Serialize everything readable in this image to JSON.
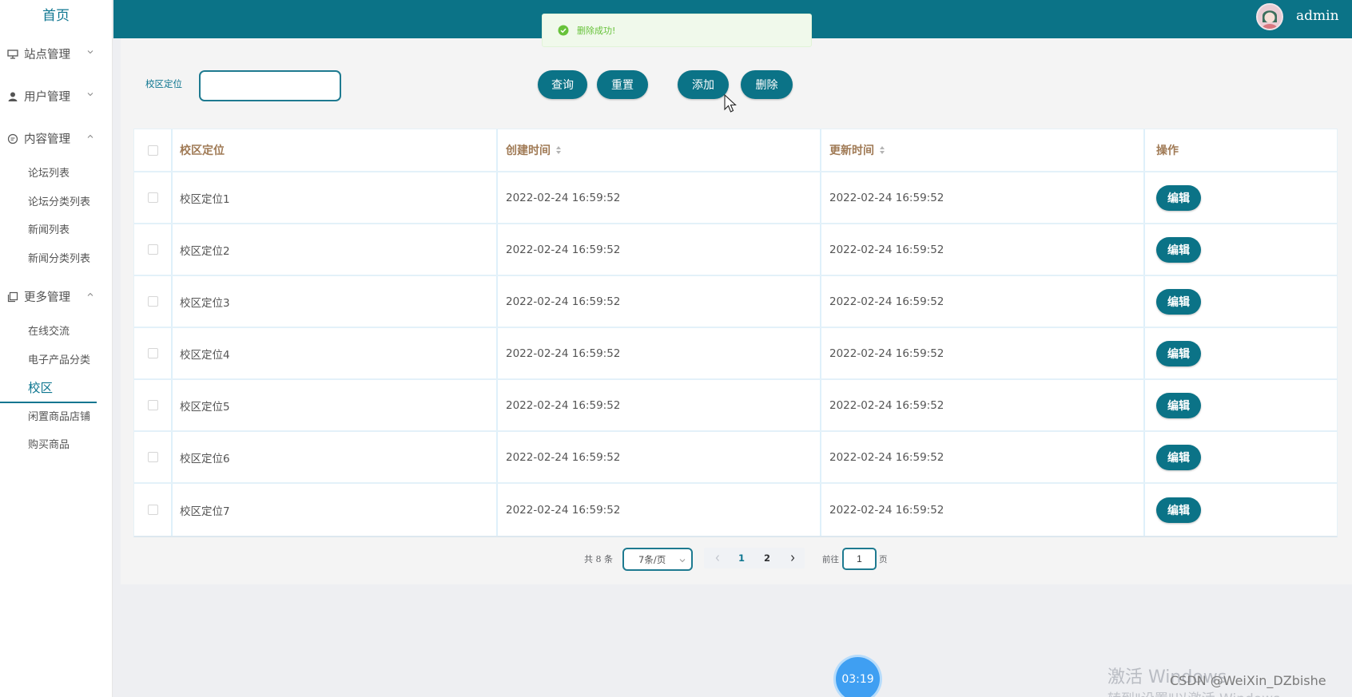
{
  "sidebar": {
    "home": "首页",
    "groups": [
      {
        "label": "站点管理"
      },
      {
        "label": "用户管理"
      },
      {
        "label": "内容管理",
        "items": [
          "论坛列表",
          "论坛分类列表",
          "新闻列表",
          "新闻分类列表"
        ]
      },
      {
        "label": "更多管理",
        "items": [
          "在线交流",
          "电子产品分类",
          "校区",
          "闲置商品店铺",
          "购买商品"
        ]
      }
    ],
    "active_item": "校区"
  },
  "topbar": {
    "username": "admin"
  },
  "toast": {
    "message": "删除成功!"
  },
  "search": {
    "label": "校区定位",
    "value": ""
  },
  "buttons": {
    "query": "查询",
    "reset": "重置",
    "add": "添加",
    "delete": "删除"
  },
  "table": {
    "headers": [
      "校区定位",
      "创建时间",
      "更新时间",
      "操作"
    ],
    "rows": [
      {
        "name": "校区定位1",
        "created": "2022-02-24 16:59:52",
        "updated": "2022-02-24 16:59:52",
        "action": "编辑"
      },
      {
        "name": "校区定位2",
        "created": "2022-02-24 16:59:52",
        "updated": "2022-02-24 16:59:52",
        "action": "编辑"
      },
      {
        "name": "校区定位3",
        "created": "2022-02-24 16:59:52",
        "updated": "2022-02-24 16:59:52",
        "action": "编辑"
      },
      {
        "name": "校区定位4",
        "created": "2022-02-24 16:59:52",
        "updated": "2022-02-24 16:59:52",
        "action": "编辑"
      },
      {
        "name": "校区定位5",
        "created": "2022-02-24 16:59:52",
        "updated": "2022-02-24 16:59:52",
        "action": "编辑"
      },
      {
        "name": "校区定位6",
        "created": "2022-02-24 16:59:52",
        "updated": "2022-02-24 16:59:52",
        "action": "编辑"
      },
      {
        "name": "校区定位7",
        "created": "2022-02-24 16:59:52",
        "updated": "2022-02-24 16:59:52",
        "action": "编辑"
      }
    ]
  },
  "pagination": {
    "total": "共 8 条",
    "page_size": "7条/页",
    "pages": [
      "1",
      "2"
    ],
    "current": "1",
    "goto_label": "前往",
    "goto_value": "1",
    "unit": "页"
  },
  "timer": "03:19",
  "windows_notice": [
    "激活 Windows",
    "转到\"设置\"以激活 Windows。"
  ],
  "watermark": "CSDN @WeiXin_DZbishe",
  "colors": {
    "primary": "#0b7387",
    "success": "#67c23a",
    "header_text": "#a07a55"
  }
}
